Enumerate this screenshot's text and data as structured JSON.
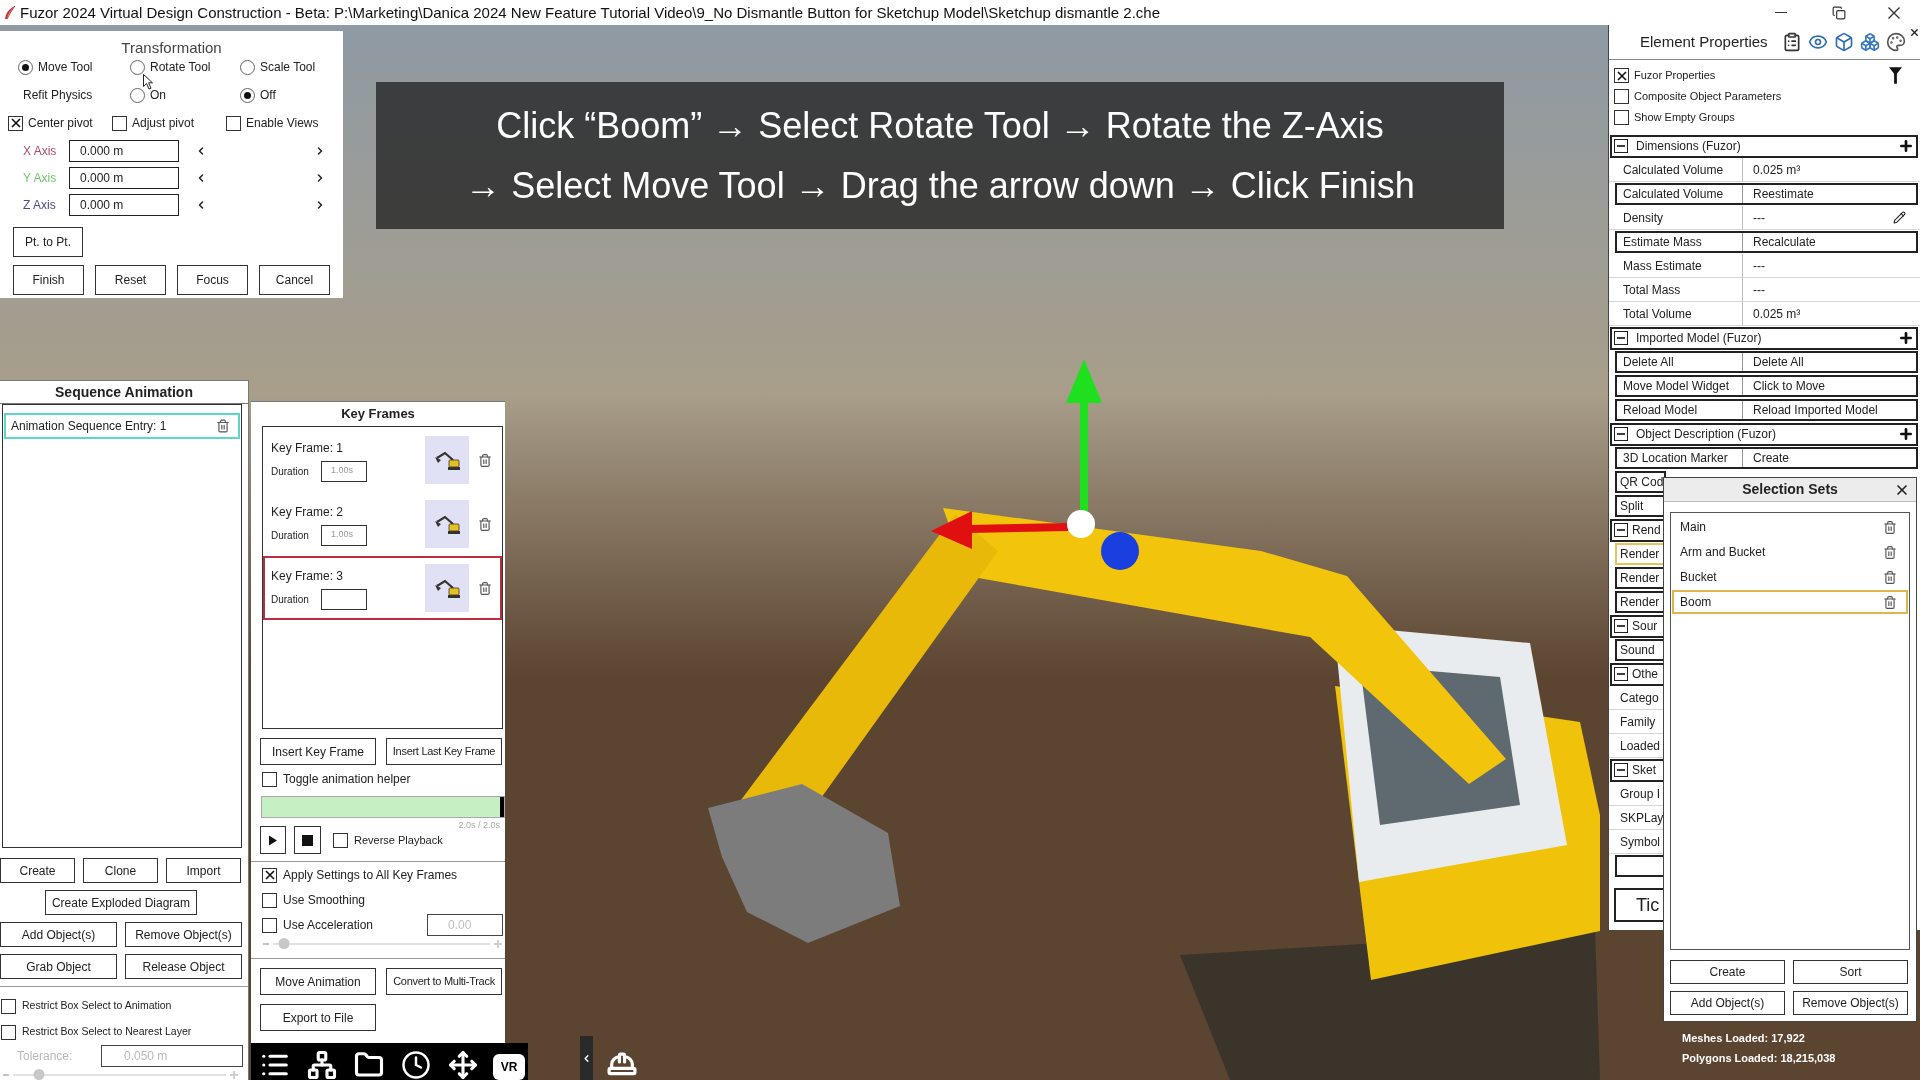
{
  "window": {
    "title": "Fuzor 2024 Virtual Design Construction - Beta: P:\\Marketing\\Danica 2024 New Feature Tutorial Video\\9_No Dismantle Button for Sketchup Model\\Sketchup dismantle 2.che"
  },
  "caption": {
    "lines": [
      "Click “Boom” → Select Rotate Tool → Rotate the Z-Axis",
      "→ Select Move Tool → Drag the arrow down → Click Finish"
    ]
  },
  "transformation": {
    "title": "Transformation",
    "tools": [
      {
        "label": "Move Tool",
        "selected": true
      },
      {
        "label": "Rotate Tool",
        "selected": false
      },
      {
        "label": "Scale Tool",
        "selected": false
      }
    ],
    "refit_physics": {
      "label": "Refit Physics",
      "options": [
        {
          "label": "On",
          "selected": false
        },
        {
          "label": "Off",
          "selected": true
        }
      ]
    },
    "pivot_options": [
      {
        "label": "Center pivot",
        "checked": true
      },
      {
        "label": "Adjust pivot",
        "checked": false
      },
      {
        "label": "Enable Views",
        "checked": false
      }
    ],
    "axes": [
      {
        "label": "X Axis",
        "value": "0.000 m",
        "color": "#b04a6e"
      },
      {
        "label": "Y Axis",
        "value": "0.000 m",
        "color": "#6cc46c"
      },
      {
        "label": "Z Axis",
        "value": "0.000 m",
        "color": "#4a4a8c"
      }
    ],
    "point_button": "Pt. to Pt.",
    "buttons": [
      "Finish",
      "Reset",
      "Focus",
      "Cancel"
    ]
  },
  "sequence_animation": {
    "title": "Sequence Animation",
    "entries": [
      {
        "label": "Animation Sequence Entry: 1",
        "selected": true
      }
    ],
    "button_rows": [
      [
        "Create",
        "Clone",
        "Import"
      ],
      [
        "Create Exploded Diagram"
      ],
      [
        "Add Object(s)",
        "Remove Object(s)"
      ],
      [
        "Grab Object",
        "Release Object"
      ]
    ],
    "options": [
      {
        "label": "Restrict Box Select to Animation",
        "checked": false
      },
      {
        "label": "Restrict Box Select to Nearest Layer",
        "checked": false
      }
    ],
    "tolerance": {
      "label": "Tolerance:",
      "value": "0.050 m",
      "disabled": true,
      "level": 0.12
    }
  },
  "key_frames": {
    "title": "Key Frames",
    "frames": [
      {
        "label": "Key Frame: 1",
        "duration_label": "Duration",
        "duration": "1.00s",
        "selected": false
      },
      {
        "label": "Key Frame: 2",
        "duration_label": "Duration",
        "duration": "1.00s",
        "selected": false
      },
      {
        "label": "Key Frame: 3",
        "duration_label": "Duration",
        "selected": true
      }
    ],
    "insert_buttons": [
      "Insert Key Frame",
      "Insert Last Key Frame"
    ],
    "helper": {
      "label": "Toggle animation helper",
      "checked": false
    },
    "progress": {
      "level": 1,
      "reading": "2.0s / 2.0s"
    },
    "reverse": {
      "label": "Reverse Playback",
      "checked": false
    },
    "settings": [
      {
        "label": "Apply Settings to All Key Frames",
        "checked": true
      },
      {
        "label": "Use Smoothing",
        "checked": false
      },
      {
        "label": "Use Acceleration",
        "checked": false
      }
    ],
    "acceleration": {
      "value": "0.00",
      "disabled": true,
      "level": 0.05
    },
    "bottom_button_rows": [
      [
        "Move Animation",
        "Convert to Multi-Track"
      ],
      [
        "Export to File"
      ]
    ]
  },
  "toolbar": {
    "vr_label": "VR"
  },
  "element_properties": {
    "title": "Element Properties",
    "filters": [
      {
        "label": "Fuzor Properties",
        "checked": true
      },
      {
        "label": "Composite Object Parameters",
        "checked": false
      },
      {
        "label": "Show Empty Groups",
        "checked": false
      }
    ],
    "sections": [
      {
        "title": "Dimensions (Fuzor)",
        "expanded": true,
        "rows": [
          {
            "kind": "value",
            "name": "Calculated Volume",
            "value": "0.025 m³",
            "selected": false
          },
          {
            "kind": "button",
            "name": "Calculated Volume",
            "value": "Reestimate",
            "selected": false
          },
          {
            "kind": "editable",
            "name": "Density",
            "value": "---",
            "selected": false
          },
          {
            "kind": "button",
            "name": "Estimate Mass",
            "value": "Recalculate",
            "selected": false
          },
          {
            "kind": "value",
            "name": "Mass Estimate",
            "value": "---",
            "selected": false
          },
          {
            "kind": "value",
            "name": "Total Mass",
            "value": "---",
            "selected": false
          },
          {
            "kind": "value",
            "name": "Total Volume",
            "value": "0.025 m³",
            "selected": false
          }
        ]
      },
      {
        "title": "Imported Model (Fuzor)",
        "expanded": true,
        "rows": [
          {
            "kind": "button",
            "name": "Delete All",
            "value": "Delete All",
            "selected": false
          },
          {
            "kind": "button",
            "name": "Move Model Widget",
            "value": "Click to Move",
            "selected": false
          },
          {
            "kind": "button",
            "name": "Reload Model",
            "value": "Reload Imported Model",
            "selected": false
          }
        ]
      },
      {
        "title": "Object Description (Fuzor)",
        "expanded": true,
        "rows": [
          {
            "kind": "button",
            "name": "3D Location Marker",
            "value": "Create",
            "selected": false
          },
          {
            "kind": "button",
            "name": "QR Cod",
            "selected": false
          },
          {
            "kind": "button",
            "name": "Split",
            "selected": false
          }
        ]
      },
      {
        "title": "Rend",
        "expanded": true,
        "rows": [
          {
            "kind": "button",
            "name": "Render",
            "selected": true
          },
          {
            "kind": "button",
            "name": "Render",
            "selected": false
          },
          {
            "kind": "button",
            "name": "Render",
            "selected": false
          }
        ]
      },
      {
        "title": "Sour",
        "expanded": true,
        "rows": [
          {
            "kind": "button",
            "name": "Sound",
            "selected": false
          }
        ]
      },
      {
        "title": "Othe",
        "expanded": true,
        "rows": [
          {
            "kind": "value",
            "name": "Catego",
            "selected": false
          },
          {
            "kind": "value",
            "name": "Family",
            "selected": false
          },
          {
            "kind": "value",
            "name": "Loaded",
            "selected": false
          }
        ]
      },
      {
        "title": "Sket",
        "expanded": true,
        "rows": [
          {
            "kind": "value",
            "name": "Group I",
            "selected": false
          },
          {
            "kind": "value",
            "name": "SKPLay",
            "selected": false
          },
          {
            "kind": "value",
            "name": "Symbol",
            "selected": false
          }
        ]
      }
    ],
    "footer": [
      {
        "kind": "blank"
      },
      {
        "kind": "button",
        "label": "Tic"
      }
    ]
  },
  "selection_sets": {
    "title": "Selection Sets",
    "items": [
      {
        "label": "Main",
        "selected": false
      },
      {
        "label": "Arm and Bucket",
        "selected": false
      },
      {
        "label": "Bucket",
        "selected": false
      },
      {
        "label": "Boom",
        "selected": true
      }
    ],
    "button_rows": [
      [
        "Create",
        "Sort"
      ],
      [
        "Add Object(s)",
        "Remove Object(s)"
      ]
    ]
  },
  "stats": {
    "lines": [
      "Meshes Loaded: 17,922",
      "Polygons Loaded: 18,215,038"
    ]
  }
}
